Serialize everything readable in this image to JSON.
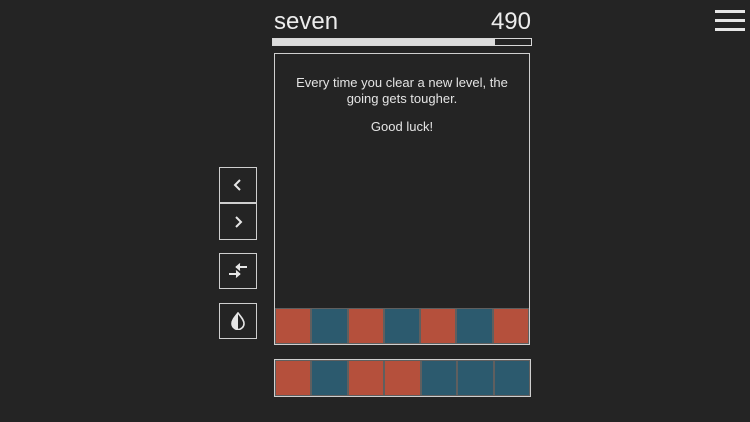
{
  "header": {
    "level_name": "seven",
    "score": "490",
    "progress_fraction": 0.86
  },
  "message": {
    "line1": "Every time you clear a new level, the going gets tougher.",
    "line2": "Good luck!"
  },
  "colors": {
    "background": "#242424",
    "red": "#b5503c",
    "blue": "#2c5a6e",
    "outline": "#cfcfcf"
  },
  "controls": {
    "left_icon": "chevron-left-icon",
    "right_icon": "chevron-right-icon",
    "swap_icon": "swap-arrows-icon",
    "drop_icon": "contrast-drop-icon",
    "menu_icon": "hamburger-menu-icon"
  },
  "board_row": [
    "red",
    "blue",
    "red",
    "blue",
    "red",
    "blue",
    "red"
  ],
  "next_row": [
    "red",
    "blue",
    "red",
    "red",
    "blue",
    "blue",
    "blue"
  ]
}
